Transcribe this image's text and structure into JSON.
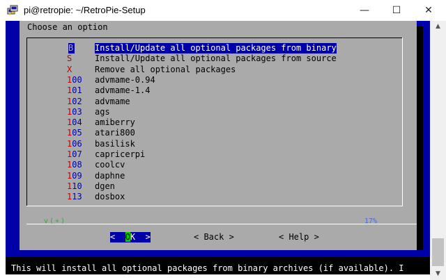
{
  "window": {
    "title": "pi@retropie: ~/RetroPie-Setup",
    "minimize_glyph": "—",
    "maximize_glyph": "☐",
    "close_glyph": "✕"
  },
  "dialog": {
    "title": "Choose an option",
    "menu": [
      {
        "tag": "B",
        "label": "Install/Update all optional packages from binary",
        "selected": true
      },
      {
        "tag": "S",
        "label": "Install/Update all optional packages from source"
      },
      {
        "tag": "X",
        "label": "Remove all optional packages"
      },
      {
        "tag": "100",
        "label": "advmame-0.94"
      },
      {
        "tag": "101",
        "label": "advmame-1.4"
      },
      {
        "tag": "102",
        "label": "advmame"
      },
      {
        "tag": "103",
        "label": "ags"
      },
      {
        "tag": "104",
        "label": "amiberry"
      },
      {
        "tag": "105",
        "label": "atari800"
      },
      {
        "tag": "106",
        "label": "basilisk"
      },
      {
        "tag": "107",
        "label": "capricerpi"
      },
      {
        "tag": "108",
        "label": "coolcv"
      },
      {
        "tag": "109",
        "label": "daphne"
      },
      {
        "tag": "110",
        "label": "dgen"
      },
      {
        "tag": "113",
        "label": "dosbox"
      }
    ],
    "scroll_percent": "17%",
    "more_indicator": "v(+)",
    "buttons": {
      "ok_left": "<  ",
      "ok_hot": "O",
      "ok_right": "K  >",
      "back": "< Back >",
      "help": "< Help >"
    }
  },
  "status_line": "This will install all optional packages from binary archives (if available). I",
  "colors": {
    "terminal_bg": "#000000",
    "dialog_bg": "#aaaaaa",
    "selection": "#0000a8",
    "tag_red": "#c00000"
  }
}
